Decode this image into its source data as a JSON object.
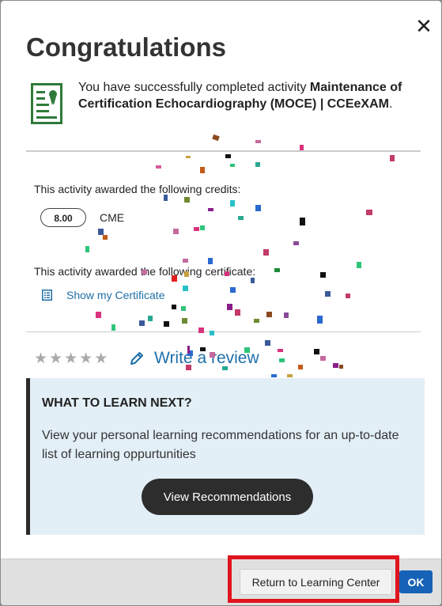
{
  "dialog": {
    "title": "Congratulations",
    "close_glyph": "✕",
    "completion_prefix": "You have successfully completed activity ",
    "activity_name": "Maintenance of Certification Echocardiography (MOCE) | CCEeXAM",
    "completion_suffix": ".",
    "certificate_icon": "certificate-icon"
  },
  "credits": {
    "label": "This activity awarded the following credits:",
    "items": [
      {
        "amount": "8.00",
        "type": "CME"
      }
    ]
  },
  "certificate": {
    "label": "This activity awarded the following certificate:",
    "link_label": "Show my Certificate",
    "icon": "document-icon"
  },
  "review": {
    "stars_total": 5,
    "rating": 0,
    "star_glyph": "★",
    "link_label": "Write a review",
    "icon": "pencil-icon"
  },
  "learn_next": {
    "heading": "WHAT TO LEARN NEXT?",
    "description": "View your personal learning recommendations for an up-to-date list of learning oppurtunities",
    "button_label": "View Recommendations"
  },
  "footer": {
    "return_label": "Return to Learning Center",
    "ok_label": "OK"
  },
  "colors": {
    "accent": "#1f6fa8",
    "ok_button": "#1662b6",
    "highlight": "#e0141c",
    "learn_bg": "#e3eff7",
    "certificate_green": "#2f7a3a"
  }
}
